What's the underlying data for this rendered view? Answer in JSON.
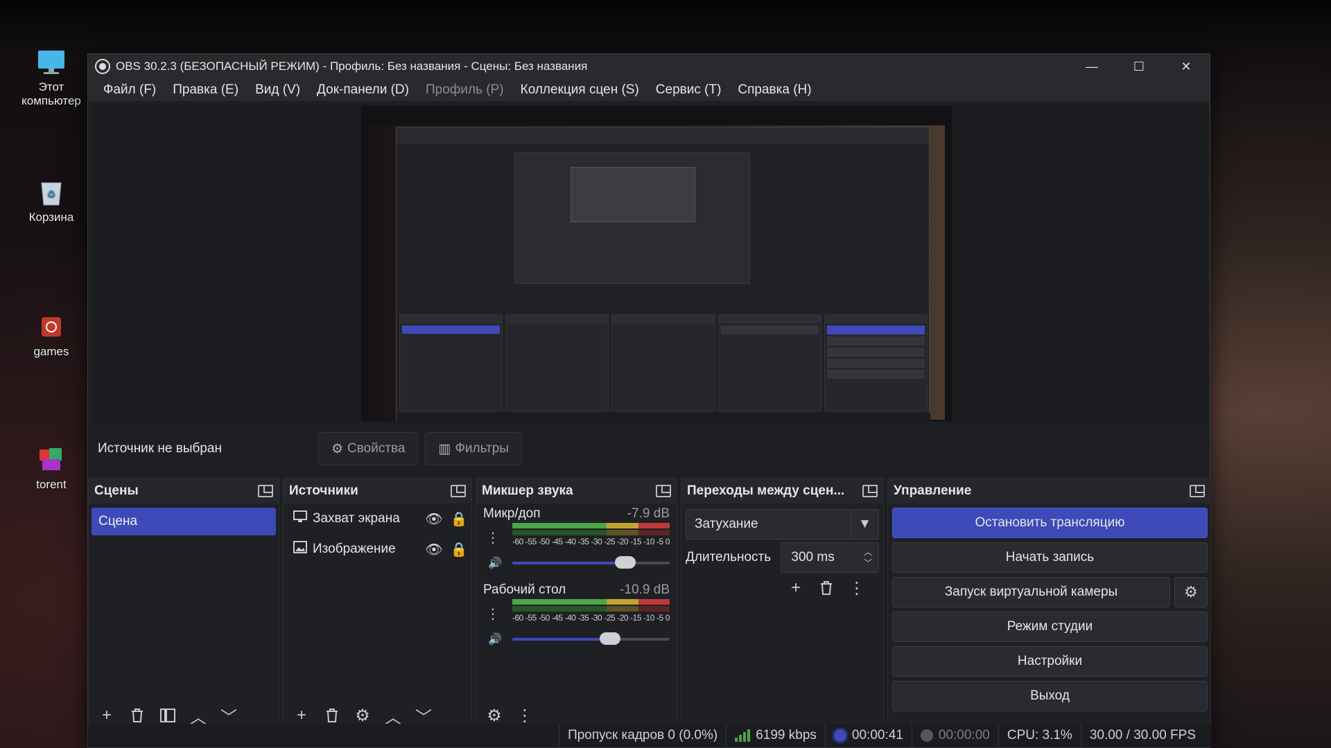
{
  "desktop": {
    "icons": [
      {
        "label": "Этот компьютер",
        "icon": "monitor-icon"
      },
      {
        "label": "Корзина",
        "icon": "recycle-bin-icon"
      },
      {
        "label": "games",
        "icon": "games-folder-icon"
      },
      {
        "label": "torent",
        "icon": "torrent-app-icon"
      }
    ]
  },
  "window": {
    "title": "OBS 30.2.3 (БЕЗОПАСНЫЙ РЕЖИМ) - Профиль: Без названия - Сцены: Без названия",
    "controls": {
      "minimize": "—",
      "maximize": "☐",
      "close": "✕"
    }
  },
  "menu": [
    {
      "label": "Файл (F)",
      "disabled": false
    },
    {
      "label": "Правка (E)",
      "disabled": false
    },
    {
      "label": "Вид (V)",
      "disabled": false
    },
    {
      "label": "Док-панели (D)",
      "disabled": false
    },
    {
      "label": "Профиль (P)",
      "disabled": true
    },
    {
      "label": "Коллекция сцен (S)",
      "disabled": false
    },
    {
      "label": "Сервис (T)",
      "disabled": false
    },
    {
      "label": "Справка (H)",
      "disabled": false
    }
  ],
  "context": {
    "no_source": "Источник не выбран",
    "properties": "Свойства",
    "filters": "Фильтры"
  },
  "scenes": {
    "header": "Сцены",
    "items": [
      "Сцена"
    ]
  },
  "sources": {
    "header": "Источники",
    "items": [
      {
        "name": "Захват экрана",
        "icon": "monitor-icon"
      },
      {
        "name": "Изображение",
        "icon": "image-icon"
      }
    ]
  },
  "mixer": {
    "header": "Микшер звука",
    "channels": [
      {
        "name": "Микр/доп",
        "db": "-7.9 dB",
        "level": 0.72
      },
      {
        "name": "Рабочий стол",
        "db": "-10.9 dB",
        "level": 0.62
      }
    ],
    "ticks": [
      "-60",
      "-55",
      "-50",
      "-45",
      "-40",
      "-35",
      "-30",
      "-25",
      "-20",
      "-15",
      "-10",
      "-5",
      "0"
    ]
  },
  "transitions": {
    "header": "Переходы между сцен...",
    "selected": "Затухание",
    "duration_label": "Длительность",
    "duration_value": "300 ms"
  },
  "controls": {
    "header": "Управление",
    "stop_stream": "Остановить трансляцию",
    "start_record": "Начать запись",
    "virtual_cam": "Запуск виртуальной камеры",
    "studio_mode": "Режим студии",
    "settings": "Настройки",
    "exit": "Выход"
  },
  "status": {
    "dropped": "Пропуск кадров 0 (0.0%)",
    "bitrate": "6199 kbps",
    "stream_time": "00:00:41",
    "record_time": "00:00:00",
    "cpu": "CPU: 3.1%",
    "fps": "30.00 / 30.00 FPS"
  },
  "colors": {
    "accent": "#3d4ab8",
    "meter_green": "#4aa64a",
    "meter_yellow": "#c1a332",
    "meter_red": "#c0393b"
  }
}
